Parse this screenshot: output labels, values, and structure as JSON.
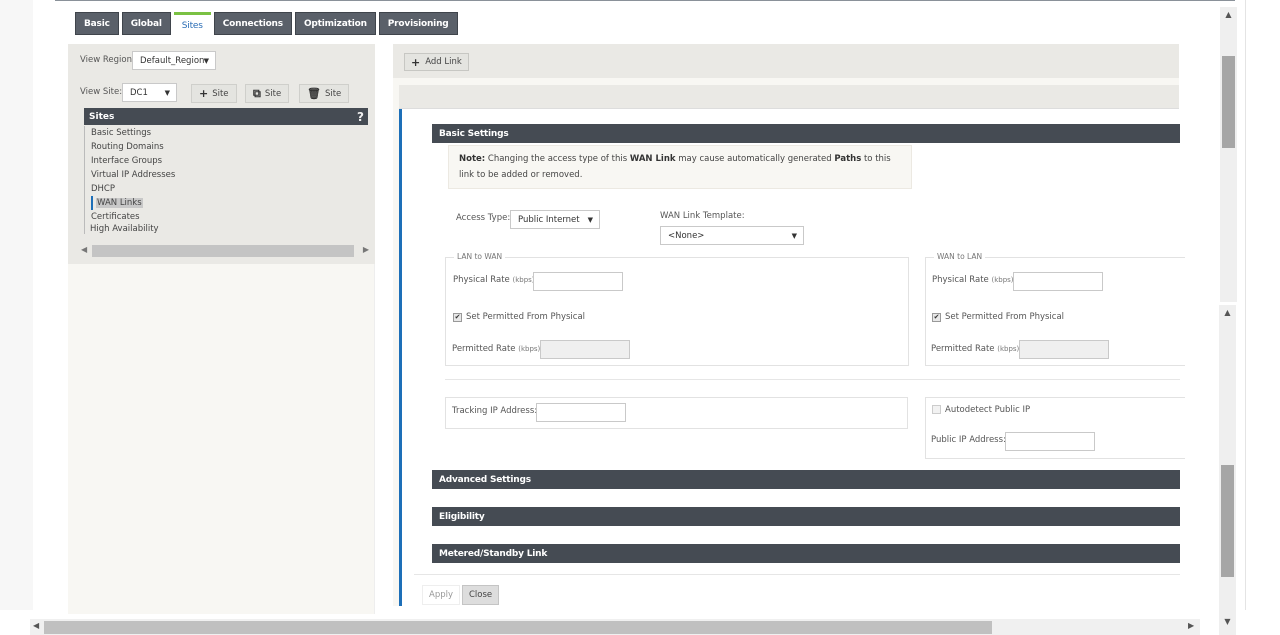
{
  "tabs": [
    {
      "label": "Basic",
      "active": false
    },
    {
      "label": "Global",
      "active": false
    },
    {
      "label": "Sites",
      "active": true
    },
    {
      "label": "Connections",
      "active": false
    },
    {
      "label": "Optimization",
      "active": false
    },
    {
      "label": "Provisioning",
      "active": false
    }
  ],
  "left": {
    "view_region_label": "View Region:",
    "view_region_value": "Default_Region",
    "view_site_label": "View Site:",
    "view_site_value": "DC1",
    "add_site_label": "Site",
    "clone_site_label": "Site",
    "delete_site_label": "Site",
    "sites_header": "Sites",
    "help_label": "?",
    "tree": [
      "Basic Settings",
      "Routing Domains",
      "Interface Groups",
      "Virtual IP Addresses",
      "DHCP",
      "WAN Links",
      "Certificates"
    ],
    "selected_item": "WAN Links",
    "high_availability": "High Availability"
  },
  "right": {
    "add_link_label": "Add Link",
    "basic_settings_title": "Basic Settings",
    "note": {
      "prefix": "Note:",
      "text1": " Changing the access type of this ",
      "bold1": "WAN Link",
      "text2": " may cause automatically generated ",
      "bold2": "Paths",
      "text3": " to this link to be added or removed."
    },
    "access_type_label": "Access Type:",
    "access_type_value": "Public Internet",
    "template_label": "WAN Link Template:",
    "template_value": "<None>",
    "lan_to_wan": {
      "legend": "LAN to WAN",
      "physical_rate_label": "Physical Rate",
      "unit": "(kbps):",
      "physical_rate_value": "",
      "set_permitted_label": "Set Permitted From Physical",
      "set_permitted_checked": true,
      "permitted_rate_label": "Permitted Rate",
      "permitted_rate_value": ""
    },
    "wan_to_lan": {
      "legend": "WAN to LAN",
      "physical_rate_label": "Physical Rate",
      "unit": "(kbps):",
      "physical_rate_value": "",
      "set_permitted_label": "Set Permitted From Physical",
      "set_permitted_checked": true,
      "permitted_rate_label": "Permitted Rate",
      "permitted_rate_value": ""
    },
    "tracking_ip_label": "Tracking IP Address:",
    "tracking_ip_value": "",
    "autodetect_label": "Autodetect Public IP",
    "autodetect_checked": false,
    "public_ip_label": "Public IP Address:",
    "public_ip_value": "",
    "sections": [
      "Advanced Settings",
      "Eligibility",
      "Metered/Standby Link"
    ],
    "apply_label": "Apply",
    "close_label": "Close"
  }
}
